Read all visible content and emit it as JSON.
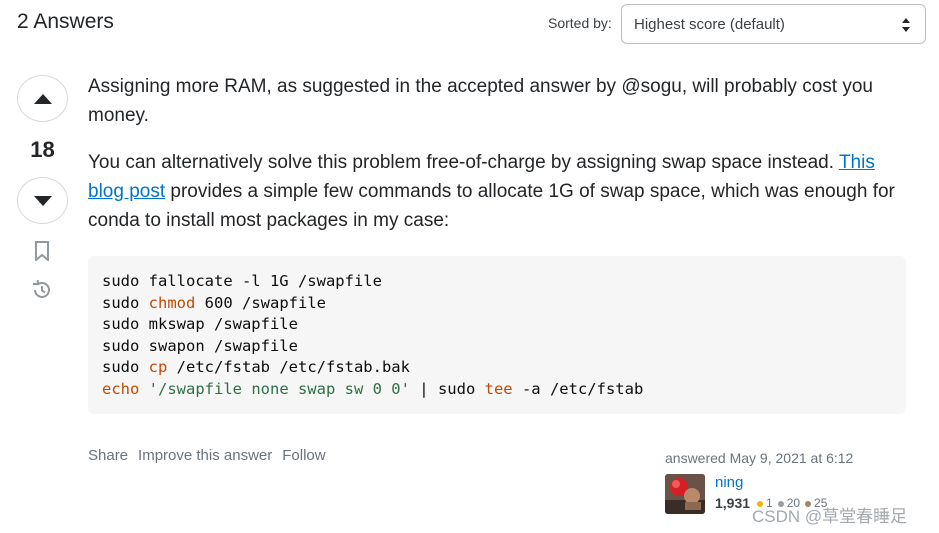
{
  "header": {
    "title": "2 Answers",
    "sort_label": "Sorted by:",
    "sort_value": "Highest score (default)"
  },
  "votes": {
    "count": "18"
  },
  "icons": {
    "upvote": "upvote-triangle-icon",
    "downvote": "downvote-triangle-icon",
    "bookmark": "bookmark-icon",
    "history": "history-icon",
    "sort_arrows": "sort-arrows-icon"
  },
  "post": {
    "p1": "Assigning more RAM, as suggested in the accepted answer by @sogu, will probably cost you money.",
    "p2_before": "You can alternatively solve this problem free-of-charge by assigning swap space instead. ",
    "p2_link": "This blog post",
    "p2_after": " provides a simple few commands to allocate 1G of swap space, which was enough for conda to install most packages in my case:",
    "code_lines": [
      [
        {
          "t": "sudo fallocate -l 1G /swapfile",
          "c": ""
        }
      ],
      [
        {
          "t": "sudo ",
          "c": ""
        },
        {
          "t": "chmod",
          "c": "kw"
        },
        {
          "t": " 600 /swapfile",
          "c": ""
        }
      ],
      [
        {
          "t": "sudo mkswap /swapfile",
          "c": ""
        }
      ],
      [
        {
          "t": "sudo swapon /swapfile",
          "c": ""
        }
      ],
      [
        {
          "t": "sudo ",
          "c": ""
        },
        {
          "t": "cp",
          "c": "kw"
        },
        {
          "t": " /etc/fstab /etc/fstab.bak",
          "c": ""
        }
      ],
      [
        {
          "t": "echo",
          "c": "kw"
        },
        {
          "t": " ",
          "c": ""
        },
        {
          "t": "'/swapfile none swap sw 0 0'",
          "c": "str"
        },
        {
          "t": " | sudo ",
          "c": ""
        },
        {
          "t": "tee",
          "c": "kw"
        },
        {
          "t": " -a /etc/fstab",
          "c": ""
        }
      ]
    ]
  },
  "menu": {
    "share": "Share",
    "improve": "Improve this answer",
    "follow": "Follow"
  },
  "user": {
    "answered": "answered May 9, 2021 at 6:12",
    "name": "ning",
    "reputation": "1,931",
    "gold": "1",
    "silver": "20",
    "bronze": "25"
  },
  "watermark": "CSDN @草堂春睡足",
  "colors": {
    "link": "#0074cc",
    "keyword": "#c04b00",
    "string": "#2f6f44",
    "code_bg": "#f6f6f6"
  }
}
